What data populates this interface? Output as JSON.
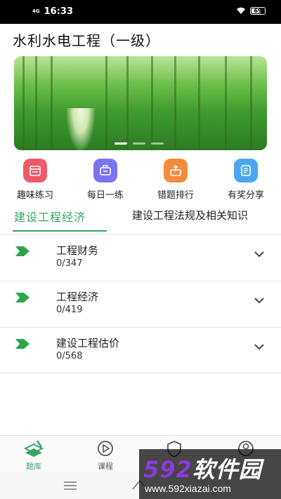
{
  "status_bar": {
    "network": "4G",
    "time": "16:33",
    "battery": "69"
  },
  "page_title": "水利水电工程（一级）",
  "banner": {
    "slides": 3,
    "active_slide": 1
  },
  "quick_actions": [
    {
      "label": "趣味练习",
      "icon": "calendar-icon",
      "color": "#ee5a6a"
    },
    {
      "label": "每日一练",
      "icon": "briefcase-icon",
      "color": "#7b74f0"
    },
    {
      "label": "错题排行",
      "icon": "share-box-icon",
      "color": "#f38b3c"
    },
    {
      "label": "有奖分享",
      "icon": "notebook-icon",
      "color": "#4aa6f0"
    }
  ],
  "tabs": [
    {
      "label": "建设工程经济",
      "active": true
    },
    {
      "label": "建设工程法规及相关知识",
      "active": false
    }
  ],
  "chapters": [
    {
      "name": "工程财务",
      "count": "0/347"
    },
    {
      "name": "工程经济",
      "count": "0/419"
    },
    {
      "name": "建设工程估价",
      "count": "0/568"
    }
  ],
  "bottom_nav": [
    {
      "label": "题库",
      "icon": "question-bank-icon",
      "active": true
    },
    {
      "label": "课程",
      "icon": "play-circle-icon",
      "active": false
    },
    {
      "label": "",
      "icon": "shield-icon",
      "active": false
    },
    {
      "label": "",
      "icon": "user-icon",
      "active": false
    }
  ],
  "watermark": {
    "number": "592",
    "text": "软件园",
    "url": "www.592xiazai.com"
  },
  "colors": {
    "accent": "#36a466",
    "divider": "#e3e3e3"
  }
}
